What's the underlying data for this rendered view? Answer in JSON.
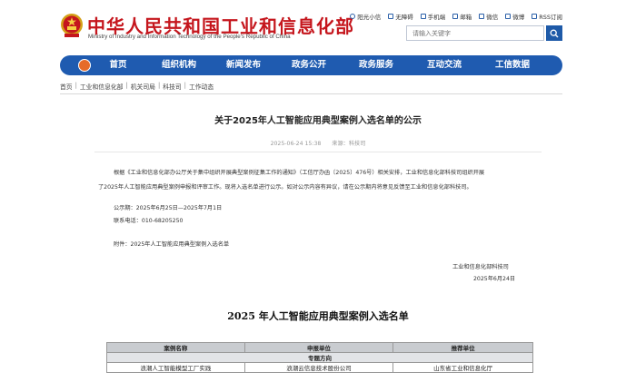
{
  "header": {
    "title": "中华人民共和国工业和信息化部",
    "subtitle": "Ministry of Industry and Information Technology of the People's Republic of China",
    "emblem_icon": "national-emblem-icon",
    "brand_color": "#c5161d",
    "top_links": [
      {
        "label": "阳光小信",
        "icon": "sun-icon"
      },
      {
        "label": "无障碍",
        "icon": "accessibility-icon"
      },
      {
        "label": "手机端",
        "icon": "mobile-icon"
      },
      {
        "label": "邮箱",
        "icon": "mail-icon"
      },
      {
        "label": "微信",
        "icon": "wechat-icon"
      },
      {
        "label": "微博",
        "icon": "weibo-icon"
      },
      {
        "label": "RSS订阅",
        "icon": "rss-icon"
      }
    ],
    "search": {
      "placeholder": "请输入关键字",
      "button_icon": "search-icon"
    }
  },
  "nav": {
    "color": "#1f5bb0",
    "items": [
      "首页",
      "组织机构",
      "新闻发布",
      "政务公开",
      "政务服务",
      "互动交流",
      "工信数据"
    ]
  },
  "breadcrumb": [
    "首页",
    "工业和信息化部",
    "机关司局",
    "科技司",
    "工作动态"
  ],
  "article": {
    "title": "关于2025年人工智能应用典型案例入选名单的公示",
    "date": "2025-06-24 15:38",
    "source": "来源：科技司",
    "para1_line1": "根据《工业和信息化部办公厅关于集中组织开展典型案例征集工作的通知》（工信厅办函〔2025〕476号）相关安排，工业和信息化部科技司组织开展",
    "para1_line2": "了2025年人工智能应用典型案例申报和评审工作。现将入选名单进行公示。如对公示内容有异议，请在公示期内将意见反馈至工业和信息化部科技司。",
    "period": "公示期：2025年6月25日—2025年7月1日",
    "phone": "联系电话：010-68205250",
    "attachment": "附件：2025年人工智能应用典型案例入选名单",
    "signature": "工业和信息化部科技司",
    "sign_date": "2025年6月24日"
  },
  "list": {
    "title": "2025 年人工智能应用典型案例入选名单",
    "headers": [
      "案例名称",
      "申报单位",
      "推荐单位"
    ],
    "section": "专题方向",
    "rows": [
      [
        "浪潮人工智能模型工厂实践",
        "浪潮云信息技术股份公司",
        "山东省工业和信息化厅"
      ]
    ]
  }
}
